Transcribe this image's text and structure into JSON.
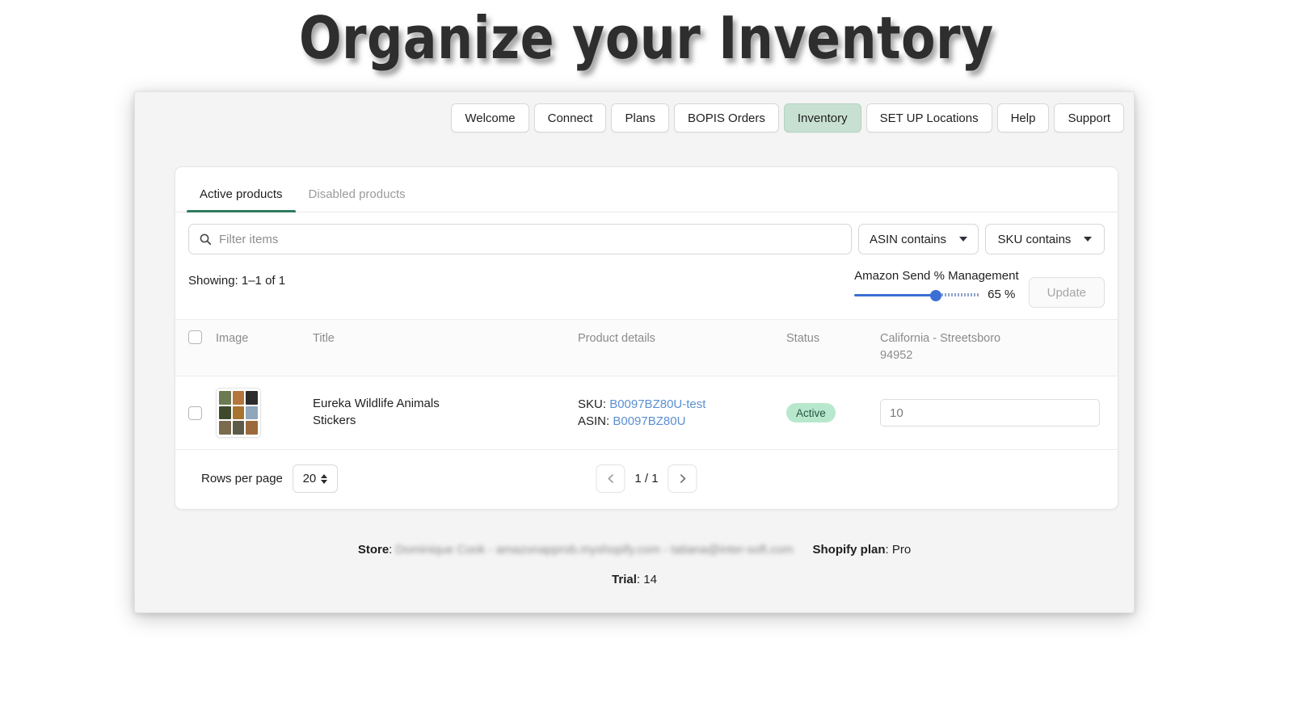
{
  "hero": {
    "title": "Organize your Inventory"
  },
  "nav": {
    "items": [
      {
        "label": "Welcome",
        "active": false
      },
      {
        "label": "Connect",
        "active": false
      },
      {
        "label": "Plans",
        "active": false
      },
      {
        "label": "BOPIS Orders",
        "active": false
      },
      {
        "label": "Inventory",
        "active": true
      },
      {
        "label": "SET UP Locations",
        "active": false
      },
      {
        "label": "Help",
        "active": false
      },
      {
        "label": "Support",
        "active": false
      }
    ],
    "active_color": "#c8e0d2"
  },
  "tabs": [
    {
      "label": "Active products",
      "active": true
    },
    {
      "label": "Disabled products",
      "active": false
    }
  ],
  "tab_accent": "#2f7a5c",
  "filter": {
    "search_placeholder": "Filter items",
    "search_value": "",
    "search_icon": "search-icon",
    "dropdowns": [
      {
        "label": "ASIN contains",
        "icon": "chevron-down-icon"
      },
      {
        "label": "SKU contains",
        "icon": "chevron-down-icon"
      }
    ]
  },
  "meta": {
    "showing": "Showing: 1–1 of 1",
    "slider_label": "Amazon Send % Management",
    "slider_value": 65,
    "slider_value_text": "65 %",
    "slider_color": "#3b6fd4",
    "update_label": "Update"
  },
  "table": {
    "headers": {
      "image": "Image",
      "title": "Title",
      "details": "Product details",
      "status": "Status",
      "location_line1": "California - Streetsboro",
      "location_line2": "94952"
    },
    "rows": [
      {
        "title": "Eureka Wildlife Animals Stickers",
        "sku_label": "SKU:",
        "sku_value": "B0097BZ80U-test",
        "asin_label": "ASIN:",
        "asin_value": "B0097BZ80U",
        "status": "Active",
        "status_color": "#b7e8cd",
        "quantity": "10"
      }
    ]
  },
  "pagination": {
    "rows_label": "Rows per page",
    "rows_value": "20",
    "page_info": "1 / 1",
    "prev_icon": "chevron-left-icon",
    "next_icon": "chevron-right-icon"
  },
  "footer": {
    "store_label": "Store",
    "store_value": "Dominique Cook - amazonapprob.myshopify.com - tatiana@inter-soft.com",
    "plan_label": "Shopify plan",
    "plan_value": "Pro",
    "trial_label": "Trial",
    "trial_value": "14"
  }
}
